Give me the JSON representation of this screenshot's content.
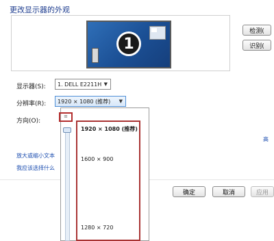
{
  "window": {
    "title": "更改显示器的外观"
  },
  "preview": {
    "monitor_number": "1"
  },
  "buttons": {
    "detect": "检测(",
    "identify": "识别(",
    "ok": "确定",
    "cancel": "取消",
    "apply": "应用"
  },
  "display_field": {
    "label": "显示器(S):",
    "value": "1. DELL E2211H"
  },
  "resolution_field": {
    "label": "分辨率(R):",
    "value": "1920 × 1080 (推荐)"
  },
  "orientation_field": {
    "label": "方向(O):"
  },
  "resolution_dropdown": {
    "options": [
      "1920 × 1080 (推荐)",
      "1600 × 900",
      "1280 × 720"
    ],
    "selected": "1920 × 1080 (推荐)"
  },
  "links": {
    "text_size": "放大或缩小文本",
    "which_settings": "我应该选择什么",
    "advanced": "高"
  },
  "colors": {
    "accent": "#1e3d8f",
    "highlight_box": "#a83232",
    "link": "#1e4fb0"
  }
}
